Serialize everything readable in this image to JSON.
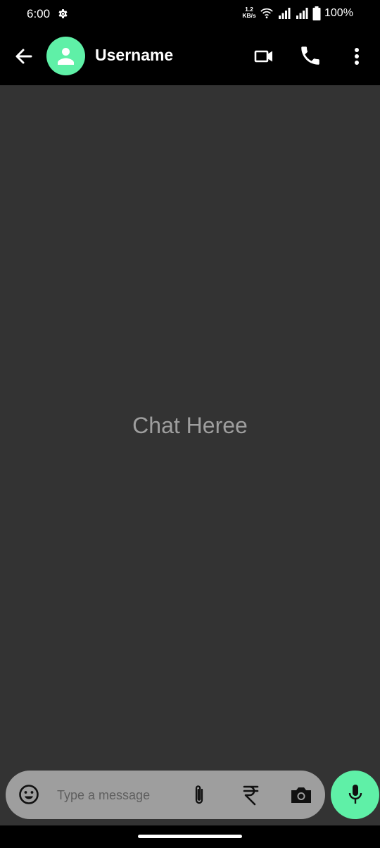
{
  "status_bar": {
    "time": "6:00",
    "speed_value": "1.2",
    "speed_unit": "KB/s",
    "battery": "100%"
  },
  "header": {
    "username": "Username"
  },
  "chat": {
    "placeholder": "Chat Heree"
  },
  "composer": {
    "placeholder": "Type a message"
  },
  "colors": {
    "accent": "#5ff0a7",
    "chat_background": "#333333",
    "input_pill": "#9e9e9e",
    "bar_background": "#000000"
  },
  "icons": {
    "status": [
      "gear-icon",
      "wifi-icon",
      "signal-icon",
      "signal-icon",
      "battery-icon"
    ],
    "header": [
      "back-arrow-icon",
      "person-icon",
      "video-camera-icon",
      "phone-icon",
      "more-vert-icon"
    ],
    "composer": [
      "emoji-icon",
      "attach-icon",
      "rupee-icon",
      "camera-icon",
      "mic-icon"
    ]
  }
}
